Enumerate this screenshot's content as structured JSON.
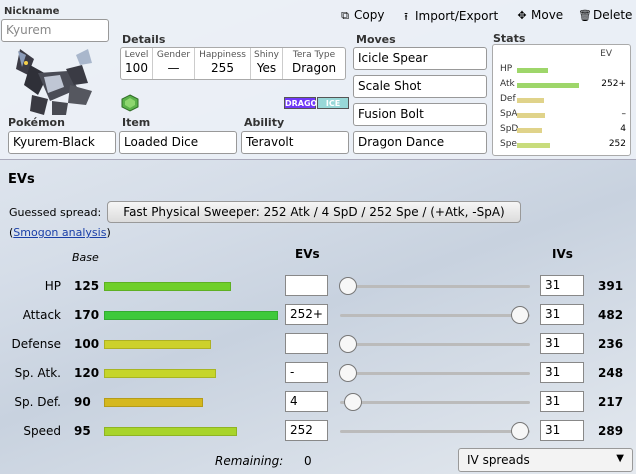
{
  "set": {
    "nickname_label": "Nickname",
    "nickname_placeholder": "Kyurem",
    "details_label": "Details",
    "details": [
      {
        "key": "Level",
        "value": "100"
      },
      {
        "key": "Gender",
        "value": "—"
      },
      {
        "key": "Happiness",
        "value": "255"
      },
      {
        "key": "Shiny",
        "value": "Yes"
      },
      {
        "key": "Tera Type",
        "value": "Dragon"
      }
    ],
    "types": [
      {
        "name": "DRAGON",
        "color": "#7038f8"
      },
      {
        "name": "ICE",
        "color": "#98d8d8"
      }
    ],
    "pokemon_label": "Pokémon",
    "pokemon": "Kyurem-Black",
    "item_label": "Item",
    "item": "Loaded Dice",
    "ability_label": "Ability",
    "ability": "Teravolt",
    "moves_label": "Moves",
    "moves": [
      "Icicle Spear",
      "Scale Shot",
      "Fusion Bolt",
      "Dragon Dance"
    ],
    "stats_label": "Stats",
    "stats_ev_head": "EV",
    "stats": [
      {
        "name": "HP",
        "ev": "",
        "fill": 0.44,
        "color": "#9ed66a"
      },
      {
        "name": "Atk",
        "ev": "252+",
        "fill": 0.88,
        "color": "#9ed66a"
      },
      {
        "name": "Def",
        "ev": "",
        "fill": 0.38,
        "color": "#e0d38a"
      },
      {
        "name": "SpA",
        "ev": "–",
        "fill": 0.4,
        "color": "#e0d38a"
      },
      {
        "name": "SpD",
        "ev": "4",
        "fill": 0.35,
        "color": "#e0d38a"
      },
      {
        "name": "Spe",
        "ev": "252",
        "fill": 0.47,
        "color": "#c8dc7c"
      }
    ]
  },
  "toolbar": {
    "copy": "Copy",
    "import_export": "Import/Export",
    "move": "Move",
    "delete": "Delete"
  },
  "evs": {
    "title": "EVs",
    "guessed_label": "Guessed spread:",
    "guessed_value": "Fast Physical Sweeper: 252 Atk / 4 SpD / 252 Spe / (+Atk, -SpA)",
    "smogon_open": "(",
    "smogon_link": "Smogon analysis",
    "smogon_close": ")",
    "base_head": "Base",
    "ev_head": "EVs",
    "iv_head": "IVs",
    "rows": [
      {
        "name": "HP",
        "base": "125",
        "base_fill": 0.49,
        "bar_color": "#6fcf2a",
        "ev": "",
        "iv": "31",
        "slider": 0.0,
        "total": "391"
      },
      {
        "name": "Attack",
        "base": "170",
        "base_fill": 0.67,
        "bar_color": "#3ec93a",
        "ev": "252+",
        "iv": "31",
        "slider": 1.0,
        "total": "482"
      },
      {
        "name": "Defense",
        "base": "100",
        "base_fill": 0.41,
        "bar_color": "#cdd12b",
        "ev": "",
        "iv": "31",
        "slider": 0.0,
        "total": "236"
      },
      {
        "name": "Sp. Atk.",
        "base": "120",
        "base_fill": 0.43,
        "bar_color": "#c6d52a",
        "ev": "-",
        "iv": "31",
        "slider": 0.0,
        "total": "248"
      },
      {
        "name": "Sp. Def.",
        "base": "90",
        "base_fill": 0.38,
        "bar_color": "#d5b81e",
        "ev": "4",
        "iv": "31",
        "slider": 0.03,
        "total": "217"
      },
      {
        "name": "Speed",
        "base": "95",
        "base_fill": 0.51,
        "bar_color": "#a8d42a",
        "ev": "252",
        "iv": "31",
        "slider": 1.0,
        "total": "289"
      }
    ],
    "remaining_label": "Remaining:",
    "remaining_value": "0",
    "iv_spreads": "IV spreads"
  }
}
